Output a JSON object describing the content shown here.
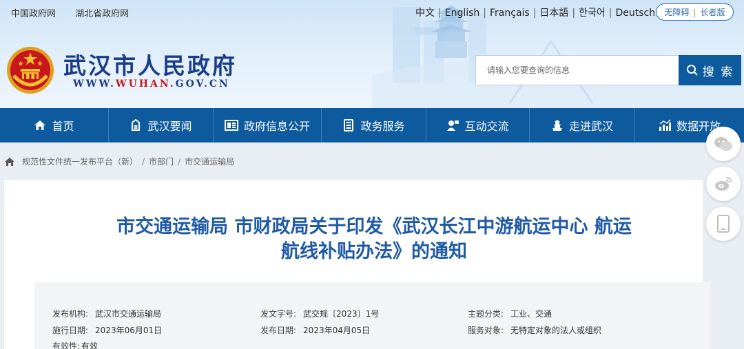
{
  "top_links": [
    "中国政府网",
    "湖北省政府网"
  ],
  "languages": [
    "中文",
    "English",
    "Français",
    "日本語",
    "한국어",
    "Deutsch"
  ],
  "accessibility": [
    "无障碍",
    "长者版"
  ],
  "site": {
    "title": "武汉市人民政府",
    "domain_prefix": "WWW.",
    "domain_highlight": "WUHAN",
    "domain_suffix": ".GOV.CN"
  },
  "search": {
    "placeholder": "请输入您要查询的信息",
    "button_label": "搜 索"
  },
  "nav": [
    {
      "label": "首页",
      "icon": "home-icon"
    },
    {
      "label": "武汉要闻",
      "icon": "news-icon"
    },
    {
      "label": "政府信息公开",
      "icon": "info-icon"
    },
    {
      "label": "政务服务",
      "icon": "service-icon"
    },
    {
      "label": "互动交流",
      "icon": "interaction-icon"
    },
    {
      "label": "走进武汉",
      "icon": "city-icon"
    },
    {
      "label": "数据开放",
      "icon": "data-icon"
    }
  ],
  "breadcrumb": [
    "规范性文件统一发布平台（新）",
    "市部门",
    "市交通运输局"
  ],
  "share_icons": [
    "wechat-icon",
    "weibo-icon",
    "mobile-icon"
  ],
  "document": {
    "title_line1": "市交通运输局 市财政局关于印发《武汉长江中游航运中心 航运",
    "title_line2": "航线补贴办法》的通知"
  },
  "meta": {
    "publisher_label": "发布机构:",
    "publisher": "武汉市交通运输局",
    "doc_no_label": "发文字号:",
    "doc_no": "武交规〔2023〕1号",
    "category_label": "主题分类:",
    "category": "工业、交通",
    "effective_label": "施行日期:",
    "effective": "2023年06月01日",
    "publish_date_label": "发布日期:",
    "publish_date": "2023年04月05日",
    "audience_label": "服务对象:",
    "audience": "无特定对象的法人或组织",
    "validity_label": "有效性:",
    "validity": "有效"
  },
  "colors": {
    "nav_bg": "#0e5a9e",
    "title_blue": "#1a3c8a",
    "doc_title": "#1f5aa6",
    "accent_red": "#c4161c"
  }
}
